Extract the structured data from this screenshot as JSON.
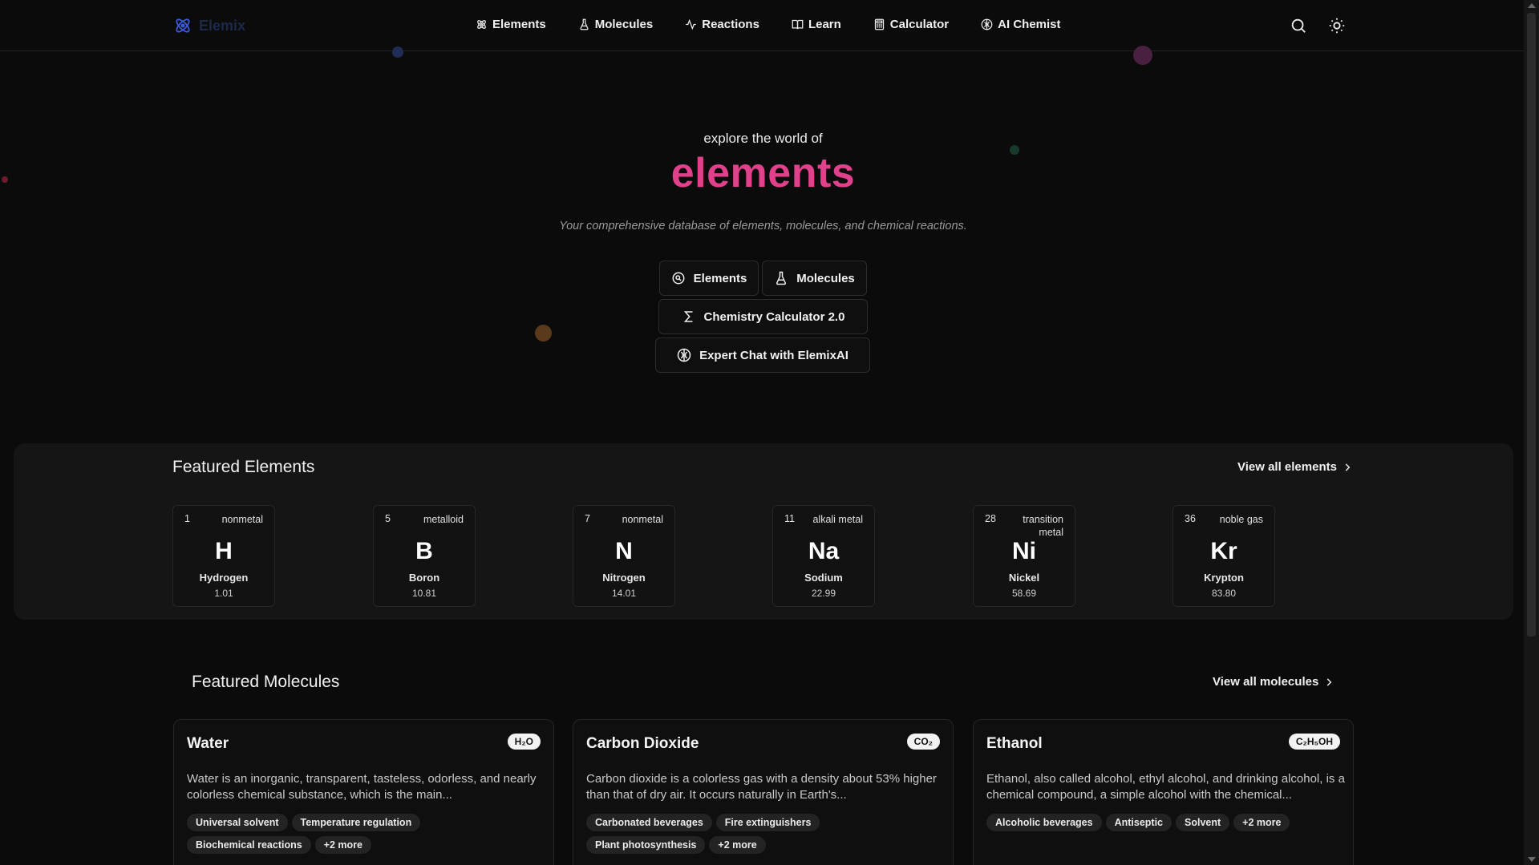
{
  "header": {
    "brand": "Elemix",
    "nav": [
      {
        "label": "Elements",
        "icon": "atom-icon"
      },
      {
        "label": "Molecules",
        "icon": "flask-icon"
      },
      {
        "label": "Reactions",
        "icon": "activity-icon"
      },
      {
        "label": "Learn",
        "icon": "book-icon"
      },
      {
        "label": "Calculator",
        "icon": "calculator-icon"
      },
      {
        "label": "AI Chemist",
        "icon": "brain-icon"
      }
    ],
    "actions": [
      "search-icon",
      "sun-icon"
    ]
  },
  "hero": {
    "pre_title": "explore the world of",
    "title": "elements",
    "subtitle": "Your comprehensive database of elements, molecules, and chemical reactions.",
    "buttons": {
      "elements": "Elements",
      "molecules": "Molecules",
      "calculator": "Chemistry Calculator 2.0",
      "chat": "Expert Chat with ElemixAI"
    }
  },
  "featured_elements": {
    "title": "Featured Elements",
    "view_all": "View all elements",
    "items": [
      {
        "number": "1",
        "category": "nonmetal",
        "symbol": "H",
        "name": "Hydrogen",
        "mass": "1.01"
      },
      {
        "number": "5",
        "category": "metalloid",
        "symbol": "B",
        "name": "Boron",
        "mass": "10.81"
      },
      {
        "number": "7",
        "category": "nonmetal",
        "symbol": "N",
        "name": "Nitrogen",
        "mass": "14.01"
      },
      {
        "number": "11",
        "category": "alkali metal",
        "symbol": "Na",
        "name": "Sodium",
        "mass": "22.99"
      },
      {
        "number": "28",
        "category": "transition metal",
        "symbol": "Ni",
        "name": "Nickel",
        "mass": "58.69"
      },
      {
        "number": "36",
        "category": "noble gas",
        "symbol": "Kr",
        "name": "Krypton",
        "mass": "83.80"
      }
    ]
  },
  "featured_molecules": {
    "title": "Featured Molecules",
    "view_all": "View all molecules",
    "items": [
      {
        "name": "Water",
        "formula": "H₂O",
        "description": "Water is an inorganic, transparent, tasteless, odorless, and nearly colorless chemical substance, which is the main...",
        "tags": [
          "Universal solvent",
          "Temperature regulation",
          "Biochemical reactions",
          "+2 more"
        ]
      },
      {
        "name": "Carbon Dioxide",
        "formula": "CO₂",
        "description": "Carbon dioxide is a colorless gas with a density about 53% higher than that of dry air. It occurs naturally in Earth's...",
        "tags": [
          "Carbonated beverages",
          "Fire extinguishers",
          "Plant photosynthesis",
          "+2 more"
        ]
      },
      {
        "name": "Ethanol",
        "formula": "C₂H₅OH",
        "description": "Ethanol, also called alcohol, ethyl alcohol, and drinking alcohol, is a chemical compound, a simple alcohol with the chemical...",
        "tags": [
          "Alcoholic beverages",
          "Antiseptic",
          "Solvent",
          "+2 more"
        ]
      }
    ]
  },
  "colors": {
    "background": "#0b0b0b",
    "accent_pink": "#e1408a",
    "panel": "#151515",
    "logo_blue": "#3b5bdb"
  }
}
